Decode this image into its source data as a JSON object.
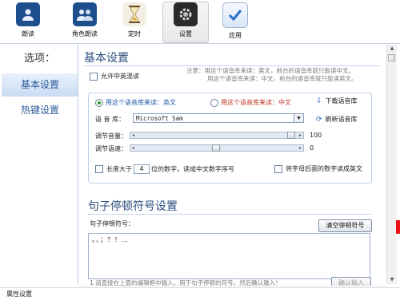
{
  "toolbar": {
    "buttons": [
      {
        "label": "朗读",
        "icon": "person-icon"
      },
      {
        "label": "角色朗读",
        "icon": "group-icon"
      },
      {
        "label": "定时",
        "icon": "hourglass-icon"
      },
      {
        "label": "设置",
        "icon": "gear-icon",
        "active": true
      },
      {
        "label": "应用",
        "icon": "checkbox-icon"
      }
    ]
  },
  "sidebar": {
    "title": "选项：",
    "items": [
      {
        "label": "基本设置",
        "active": true
      },
      {
        "label": "热键设置",
        "active": false
      }
    ]
  },
  "basic": {
    "title": "基本设置",
    "allow_mixed_label": "允许中英混读",
    "note_line1": "注意：用这个语音库来读：英文，前台的语音库就只能读中文。",
    "note_line2": "用这个语音库来读：中文，前台的语音库就只能读英文。",
    "radio_english": "用这个语音库来读：英文",
    "radio_chinese": "用这个语音库来读：中文",
    "download_label": "下载语音库",
    "voice_lib_label": "语 音 库：",
    "voice_lib_value": "Microsoft Sam",
    "refresh_label": "刷新语音库",
    "volume_label": "调节音量：",
    "volume_value": "100",
    "speed_label": "调节语速：",
    "speed_value": "0",
    "length_prefix": "长度大于",
    "length_value": "4",
    "length_suffix": "位的数字，读成中文数字序号",
    "letter_label": "将字母后面的数字读成英文"
  },
  "pause": {
    "title": "句子停顿符号设置",
    "symbols_label": "句子停顿符号：",
    "clear_button": "清空停顿符号",
    "symbols_value": "。、；？！…",
    "hint": "1.请直接在上面的编辑框中输入，用于句子停顿的符号，然后确认输入！",
    "confirm_button": "确认输入"
  },
  "status": {
    "text": "属性设置"
  },
  "colors": {
    "accent": "#2b4e7e",
    "radio_english": "#1f5aa8",
    "radio_chinese": "#c0392b",
    "sidebar_active": "#c9dcf3"
  }
}
